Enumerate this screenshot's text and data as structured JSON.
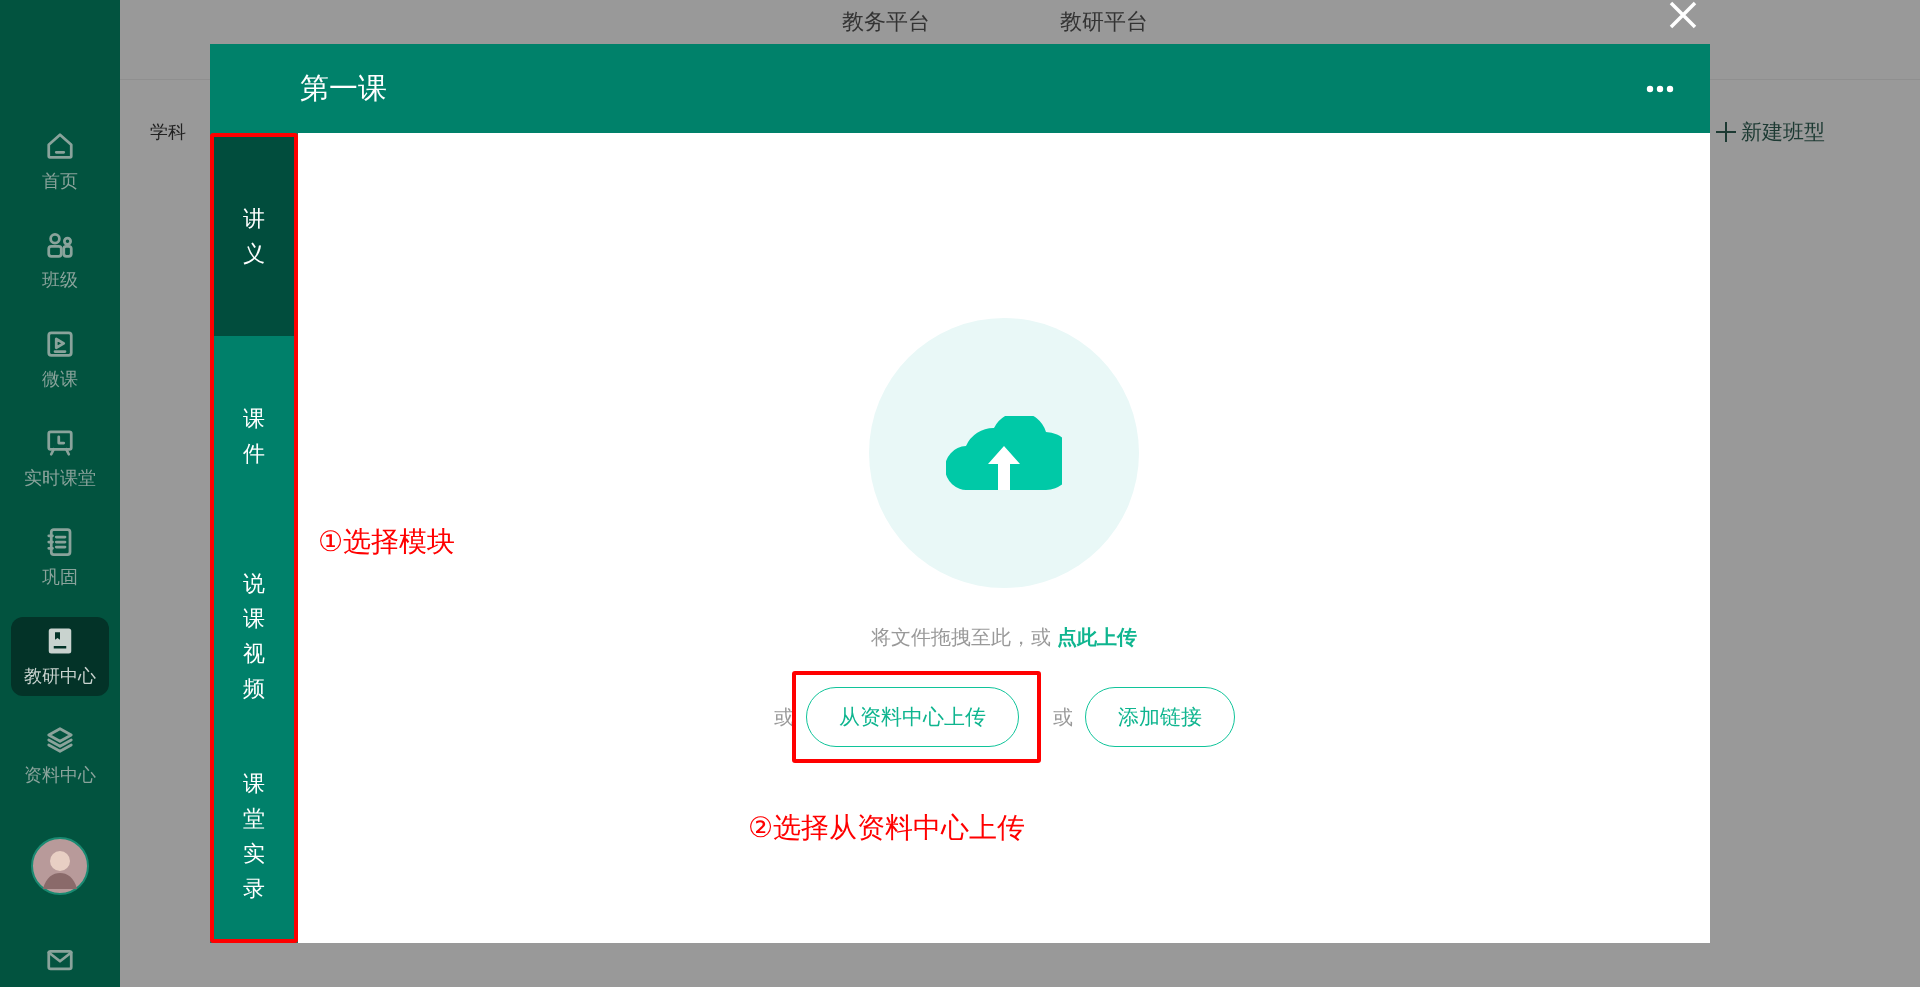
{
  "sidebar": {
    "items": [
      {
        "label": "首页",
        "kind": "home",
        "selected": false
      },
      {
        "label": "班级",
        "kind": "people",
        "selected": false
      },
      {
        "label": "微课",
        "kind": "video",
        "selected": false
      },
      {
        "label": "实时课堂",
        "kind": "board",
        "selected": false
      },
      {
        "label": "巩固",
        "kind": "notebook",
        "selected": false
      },
      {
        "label": "教研中心",
        "kind": "book",
        "selected": true
      },
      {
        "label": "资料中心",
        "kind": "layers",
        "selected": false
      }
    ]
  },
  "background": {
    "tabs": [
      {
        "label": "教务平台"
      },
      {
        "label": "教研平台"
      }
    ],
    "filter_label": "学科",
    "new_button": "新建班型"
  },
  "dialog": {
    "title": "第一课",
    "modules": [
      {
        "label": "讲义",
        "selected": true
      },
      {
        "label": "课件",
        "selected": false
      },
      {
        "label": "说课视频",
        "selected": false
      },
      {
        "label": "课堂实录",
        "selected": false
      }
    ],
    "drop_text": "将文件拖拽至此，或",
    "upload_link": "点此上传",
    "or_1": "或",
    "button_1": "从资料中心上传",
    "or_2": "或",
    "button_2": "添加链接"
  },
  "annotations": [
    {
      "text": "①选择模块"
    },
    {
      "text": "②选择从资料中心上传"
    }
  ]
}
